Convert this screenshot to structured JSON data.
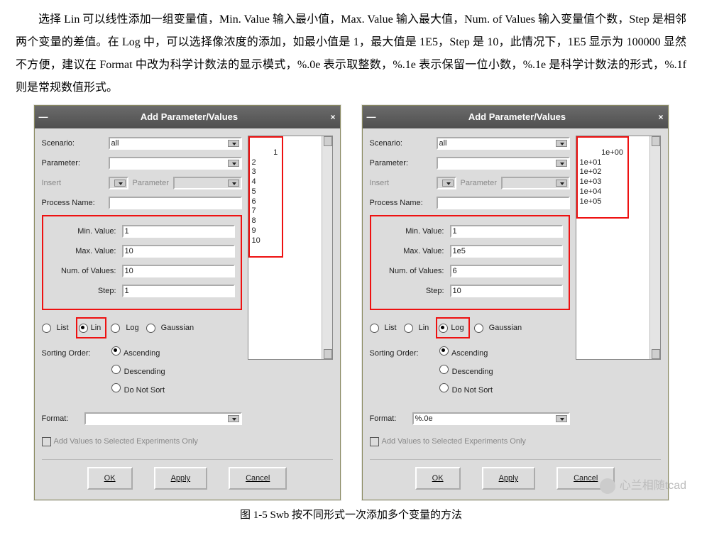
{
  "intro": {
    "p1": "选择 Lin 可以线性添加一组变量值，Min. Value 输入最小值，Max. Value 输入最大值，Num. of Values 输入变量值个数，Step 是相邻两个变量的差值。在 Log 中，可以选择像浓度的添加，如最小值是 1，最大值是 1E5，Step 是 10，此情况下，1E5 显示为 100000 显然不方便，建议在 Format 中改为科学计数法的显示模式，%.0e 表示取整数，%.1e 表示保留一位小数，%.1e 是科学计数法的形式，%.1f 则是常规数值形式。"
  },
  "dialog_title": "Add Parameter/Values",
  "labels": {
    "scenario": "Scenario:",
    "parameter": "Parameter:",
    "insert": "Insert",
    "parameter2": "Parameter",
    "process": "Process Name:",
    "min": "Min. Value:",
    "max": "Max. Value:",
    "num": "Num. of Values:",
    "step": "Step:",
    "list": "List",
    "lin": "Lin",
    "log": "Log",
    "gaussian": "Gaussian",
    "sorting": "Sorting Order:",
    "ascending": "Ascending",
    "descending": "Descending",
    "donotsort": "Do Not Sort",
    "format": "Format:",
    "addvals": "Add Values to Selected Experiments Only",
    "ok": "OK",
    "apply": "Apply",
    "cancel": "Cancel",
    "scenario_value": "all"
  },
  "left": {
    "min": "1",
    "max": "10",
    "num": "10",
    "step": "1",
    "type_checked": "Lin",
    "sort_checked": "Ascending",
    "format_value": "",
    "output": "1\n2\n3\n4\n5\n6\n7\n8\n9\n10"
  },
  "right": {
    "min": "1",
    "max": "1e5",
    "num": "6",
    "step": "10",
    "type_checked": "Log",
    "sort_checked": "Ascending",
    "format_value": "%.0e",
    "output": "1e+00\n1e+01\n1e+02\n1e+03\n1e+04\n1e+05"
  },
  "caption": "图 1-5 Swb 按不同形式一次添加多个变量的方法",
  "watermark": "心兰相随tcad"
}
